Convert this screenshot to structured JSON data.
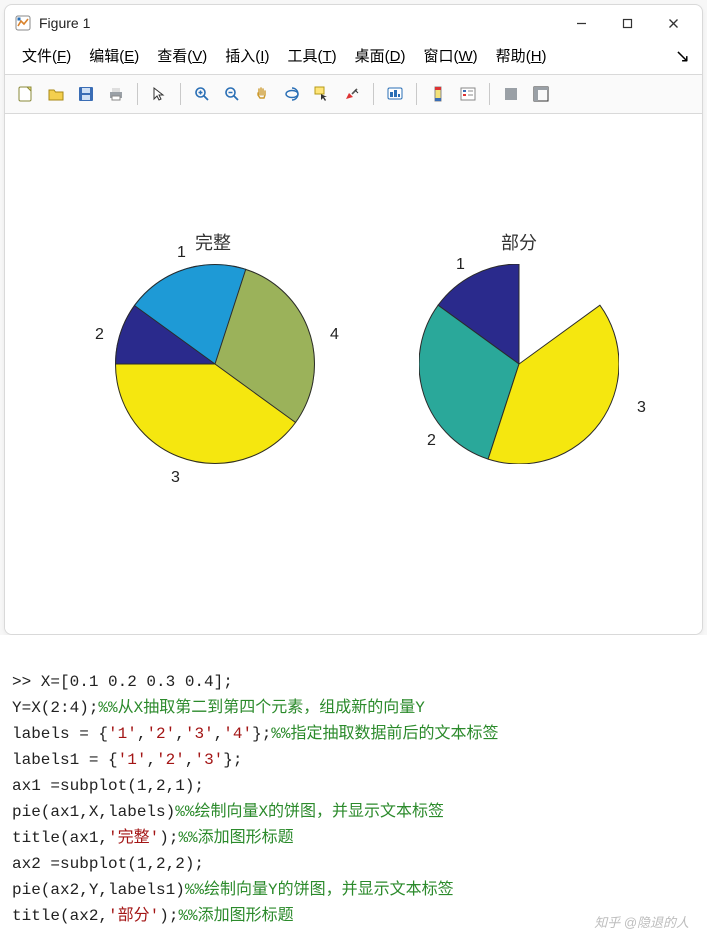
{
  "window": {
    "title": "Figure 1"
  },
  "menubar": {
    "items": [
      {
        "label": "文件",
        "accel": "F"
      },
      {
        "label": "编辑",
        "accel": "E"
      },
      {
        "label": "查看",
        "accel": "V"
      },
      {
        "label": "插入",
        "accel": "I"
      },
      {
        "label": "工具",
        "accel": "T"
      },
      {
        "label": "桌面",
        "accel": "D"
      },
      {
        "label": "窗口",
        "accel": "W"
      },
      {
        "label": "帮助",
        "accel": "H"
      }
    ]
  },
  "chart_data": [
    {
      "type": "pie",
      "title": "完整",
      "labels": [
        "1",
        "2",
        "3",
        "4"
      ],
      "values": [
        0.1,
        0.2,
        0.3,
        0.4
      ],
      "colors": [
        "#2a2a8c",
        "#1e9ad6",
        "#9bb25a",
        "#f5e70f"
      ]
    },
    {
      "type": "pie",
      "title": "部分",
      "labels": [
        "1",
        "2",
        "3"
      ],
      "values": [
        0.2,
        0.3,
        0.4
      ],
      "colors": [
        "#2a2a8c",
        "#2aa89a",
        "#f5e70f"
      ],
      "partial": true
    }
  ],
  "code": {
    "l1_pre": ">> X=[0.1 0.2 0.3 0.4];",
    "l2_pre": "Y=X(2:4);",
    "l2_cmt": "%%从X抽取第二到第四个元素，组成新的向量Y",
    "l3_a": "labels = {",
    "l3_s1": "'1'",
    "l3_s2": "'2'",
    "l3_s3": "'3'",
    "l3_s4": "'4'",
    "l3_b": "};",
    "l3_cmt": "%%指定抽取数据前后的文本标签",
    "l4_a": "labels1 = {",
    "l4_s1": "'1'",
    "l4_s2": "'2'",
    "l4_s3": "'3'",
    "l4_b": "};",
    "l5": "ax1 =subplot(1,2,1);",
    "l6_pre": "pie(ax1,X,labels)",
    "l6_cmt": "%%绘制向量X的饼图，并显示文本标签",
    "l7_a": "title(ax1,",
    "l7_s": "'完整'",
    "l7_b": ");",
    "l7_cmt": "%%添加图形标题",
    "l8": "ax2 =subplot(1,2,2);",
    "l9_pre": "pie(ax2,Y,labels1)",
    "l9_cmt": "%%绘制向量Y的饼图，并显示文本标签",
    "l10_a": "title(ax2,",
    "l10_s": "'部分'",
    "l10_b": ");",
    "l10_cmt": "%%添加图形标题"
  },
  "watermark": "知乎 @隐退的人"
}
